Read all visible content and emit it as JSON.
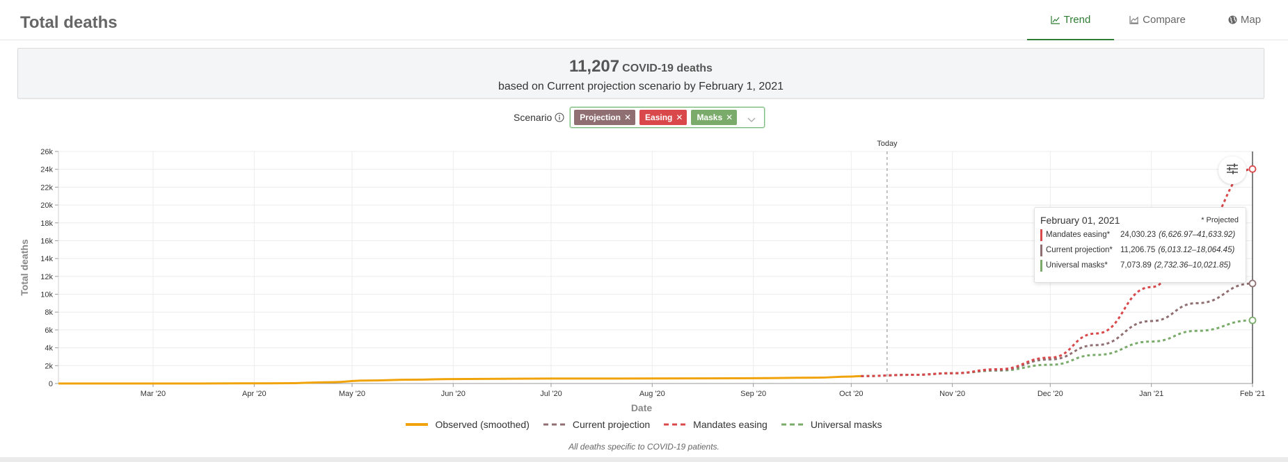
{
  "page": {
    "title": "Total deaths"
  },
  "tabs": [
    {
      "label": "Trend",
      "icon": "line-chart-icon",
      "active": true
    },
    {
      "label": "Compare",
      "icon": "area-chart-icon",
      "active": false
    },
    {
      "label": "Map",
      "icon": "globe-icon",
      "active": false
    }
  ],
  "summary": {
    "value": "11,207",
    "unit": "COVID-19 deaths",
    "subtitle": "based on Current projection scenario by February 1, 2021"
  },
  "scenario": {
    "label": "Scenario",
    "tags": [
      {
        "label": "Projection",
        "color": "#8f6f72"
      },
      {
        "label": "Easing",
        "color": "#d9484a"
      },
      {
        "label": "Masks",
        "color": "#7aab6a"
      }
    ]
  },
  "tooltip": {
    "date": "February 01, 2021",
    "projected_note": "* Projected",
    "rows": [
      {
        "name": "Mandates easing*",
        "value": "24,030.23",
        "range": "(6,626.97–41,633.92)",
        "color": "#d9484a"
      },
      {
        "name": "Current projection*",
        "value": "11,206.75",
        "range": "(6,013.12–18,064.45)",
        "color": "#8f6f72"
      },
      {
        "name": "Universal masks*",
        "value": "7,073.89",
        "range": "(2,732.36–10,021.85)",
        "color": "#7aab6a"
      }
    ]
  },
  "footnote": "All deaths specific to COVID-19 patients.",
  "chart_data": {
    "type": "line",
    "xlabel": "Date",
    "ylabel": "Total deaths",
    "x_range": [
      "2020-02-01",
      "2021-02-01"
    ],
    "ylim": [
      0,
      26000
    ],
    "y_ticks": [
      0,
      2000,
      4000,
      6000,
      8000,
      10000,
      12000,
      14000,
      16000,
      18000,
      20000,
      22000,
      24000,
      26000
    ],
    "y_tick_labels": [
      "0",
      "2k",
      "4k",
      "6k",
      "8k",
      "10k",
      "12k",
      "14k",
      "16k",
      "18k",
      "20k",
      "22k",
      "24k",
      "26k"
    ],
    "x_ticks": [
      "2020-03-01",
      "2020-04-01",
      "2020-05-01",
      "2020-06-01",
      "2020-07-01",
      "2020-08-01",
      "2020-09-01",
      "2020-10-01",
      "2020-11-01",
      "2020-12-01",
      "2021-01-01",
      "2021-02-01"
    ],
    "x_tick_labels": [
      "Mar '20",
      "Apr '20",
      "May '20",
      "Jun '20",
      "Jul '20",
      "Aug '20",
      "Sep '20",
      "Oct '20",
      "Nov '20",
      "Dec '20",
      "Jan '21",
      "Feb '21"
    ],
    "grid": true,
    "today": {
      "label": "Today",
      "date": "2020-10-12"
    },
    "legend_position": "bottom",
    "series": [
      {
        "name": "Observed (smoothed)",
        "color": "#f0a30a",
        "style": "solid",
        "points": [
          [
            "2020-02-01",
            0
          ],
          [
            "2020-03-15",
            0
          ],
          [
            "2020-04-10",
            30
          ],
          [
            "2020-04-25",
            150
          ],
          [
            "2020-05-05",
            330
          ],
          [
            "2020-05-20",
            430
          ],
          [
            "2020-06-01",
            500
          ],
          [
            "2020-06-20",
            540
          ],
          [
            "2020-07-01",
            550
          ],
          [
            "2020-08-01",
            560
          ],
          [
            "2020-09-01",
            590
          ],
          [
            "2020-09-20",
            650
          ],
          [
            "2020-10-01",
            780
          ],
          [
            "2020-10-04",
            830
          ]
        ]
      },
      {
        "name": "Current projection",
        "color": "#8f6f72",
        "style": "dashed",
        "points": [
          [
            "2020-10-04",
            830
          ],
          [
            "2020-10-20",
            970
          ],
          [
            "2020-11-01",
            1150
          ],
          [
            "2020-11-15",
            1500
          ],
          [
            "2020-12-01",
            2700
          ],
          [
            "2020-12-15",
            4300
          ],
          [
            "2021-01-01",
            7000
          ],
          [
            "2021-01-15",
            9000
          ],
          [
            "2021-02-01",
            11206.75
          ]
        ]
      },
      {
        "name": "Mandates easing",
        "color": "#d9484a",
        "style": "dashed",
        "points": [
          [
            "2020-10-04",
            830
          ],
          [
            "2020-10-20",
            970
          ],
          [
            "2020-11-01",
            1150
          ],
          [
            "2020-11-15",
            1600
          ],
          [
            "2020-12-01",
            2900
          ],
          [
            "2020-12-15",
            5600
          ],
          [
            "2021-01-01",
            10800
          ],
          [
            "2021-01-15",
            17000
          ],
          [
            "2021-02-01",
            24030.23
          ]
        ]
      },
      {
        "name": "Universal masks",
        "color": "#7aab6a",
        "style": "dashed",
        "points": [
          [
            "2020-10-04",
            830
          ],
          [
            "2020-10-20",
            970
          ],
          [
            "2020-11-01",
            1150
          ],
          [
            "2020-11-15",
            1450
          ],
          [
            "2020-12-01",
            2100
          ],
          [
            "2020-12-15",
            3200
          ],
          [
            "2021-01-01",
            4700
          ],
          [
            "2021-01-15",
            5900
          ],
          [
            "2021-02-01",
            7073.89
          ]
        ]
      }
    ]
  }
}
